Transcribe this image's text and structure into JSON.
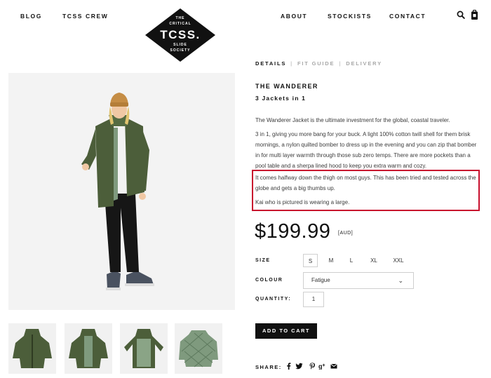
{
  "header": {
    "nav_left": [
      "BLOG",
      "TCSS CREW"
    ],
    "nav_right": [
      "ABOUT",
      "STOCKISTS",
      "CONTACT"
    ],
    "logo": {
      "line1": "THE",
      "line2": "CRITICAL",
      "main": "TCSS.",
      "line3": "SLIDE",
      "line4": "SOCIETY"
    },
    "icons": [
      "search-icon",
      "cart-icon"
    ]
  },
  "tabs": [
    "DETAILS",
    "FIT GUIDE",
    "DELIVERY"
  ],
  "product": {
    "title": "THE WANDERER",
    "subtitle": "3 Jackets in 1",
    "desc1": "The Wanderer Jacket is the ultimate investment for the global, coastal traveler.",
    "desc2": "3 in 1, giving you more bang for your buck. A light 100% cotton twill shell for them brisk mornings, a nylon quilted bomber to dress up in the evening and you can zip that bomber in for multi layer warmth through those sub zero temps. There are more pockets than a pool table and a sherpa lined hood to keep you extra warm and cozy.",
    "desc3": "It comes halfway down the thigh on most guys. This has been tried and tested across the globe and gets a big thumbs up.",
    "desc4": "Kai who is pictured is wearing a large.",
    "price": "$199.99",
    "currency": "[AUD]"
  },
  "options": {
    "size_label": "SIZE",
    "sizes": [
      "S",
      "M",
      "L",
      "XL",
      "XXL"
    ],
    "selected_size": "S",
    "colour_label": "COLOUR",
    "colour_value": "Fatigue",
    "quantity_label": "QUANTITY:",
    "quantity_value": "1"
  },
  "add_to_cart": "ADD TO CART",
  "share": {
    "label": "SHARE:",
    "icons": [
      "facebook-icon",
      "twitter-icon",
      "pinterest-icon",
      "google-plus-icon",
      "email-icon"
    ]
  },
  "colors": {
    "accent_highlight": "#c8102e",
    "jacket": "#4c5e3a",
    "button": "#111111"
  }
}
